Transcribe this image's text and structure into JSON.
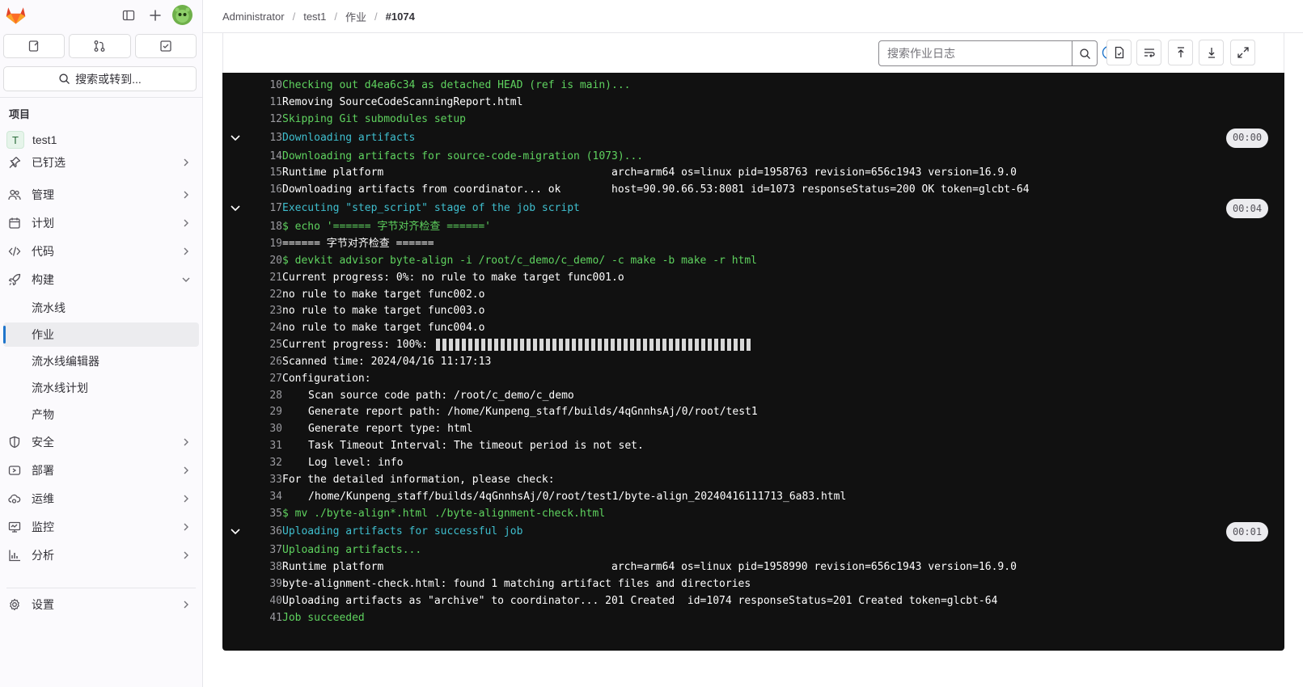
{
  "sidebar": {
    "search_label": "搜索或转到...",
    "section_title": "项目",
    "project": {
      "initial": "T",
      "name": "test1"
    },
    "items": [
      {
        "label": "已钉选",
        "icon": "pin-icon"
      },
      {
        "label": "管理",
        "icon": "users-icon"
      },
      {
        "label": "计划",
        "icon": "calendar-icon"
      },
      {
        "label": "代码",
        "icon": "code-icon"
      },
      {
        "label": "构建",
        "icon": "rocket-icon"
      },
      {
        "label": "安全",
        "icon": "shield-icon"
      },
      {
        "label": "部署",
        "icon": "deployments-icon"
      },
      {
        "label": "运维",
        "icon": "cloud-gear-icon"
      },
      {
        "label": "监控",
        "icon": "monitor-icon"
      },
      {
        "label": "分析",
        "icon": "chart-icon"
      },
      {
        "label": "设置",
        "icon": "settings-icon"
      }
    ],
    "build_subitems": [
      "流水线",
      "作业",
      "流水线编辑器",
      "流水线计划",
      "产物"
    ],
    "active_subitem": "作业"
  },
  "breadcrumb": [
    "Administrator",
    "test1",
    "作业",
    "#1074"
  ],
  "log_toolbar": {
    "search_placeholder": "搜索作业日志"
  },
  "log": {
    "lines": [
      {
        "n": "10",
        "text": "Checking out d4ea6c34 as detached HEAD (ref is main)...",
        "color": "green"
      },
      {
        "n": "11",
        "text": "Removing SourceCodeScanningReport.html",
        "color": "white"
      },
      {
        "n": "12",
        "text": "Skipping Git submodules setup",
        "color": "green"
      },
      {
        "n": "13",
        "text": "Downloading artifacts",
        "color": "cyan",
        "section": true,
        "duration": "00:00"
      },
      {
        "n": "14",
        "text": "Downloading artifacts for source-code-migration (1073)...",
        "color": "green"
      },
      {
        "n": "15",
        "text": "Runtime platform",
        "col2": "arch=arm64 os=linux pid=1958763 revision=656c1943 version=16.9.0",
        "color": "white"
      },
      {
        "n": "16",
        "text": "Downloading artifacts from coordinator... ok",
        "col2": "host=90.90.66.53:8081 id=1073 responseStatus=200 OK token=glcbt-64",
        "color": "white"
      },
      {
        "n": "17",
        "text": "Executing \"step_script\" stage of the job script",
        "color": "cyan",
        "section": true,
        "duration": "00:04"
      },
      {
        "n": "18",
        "text": "$ echo '====== 字节对齐检查 ======'",
        "color": "green"
      },
      {
        "n": "19",
        "text": "====== 字节对齐检查 ======",
        "color": "white"
      },
      {
        "n": "20",
        "text": "$ devkit advisor byte-align -i /root/c_demo/c_demo/ -c make -b make -r html",
        "color": "green"
      },
      {
        "n": "21",
        "text": "Current progress: 0%: no rule to make target func001.o",
        "color": "white"
      },
      {
        "n": "22",
        "text": "no rule to make target func002.o",
        "color": "white"
      },
      {
        "n": "23",
        "text": "no rule to make target func003.o",
        "color": "white"
      },
      {
        "n": "24",
        "text": "no rule to make target func004.o",
        "color": "white"
      },
      {
        "n": "25",
        "text": "Current progress: 100%:",
        "color": "white",
        "progress": 1.0
      },
      {
        "n": "26",
        "text": "Scanned time: 2024/04/16 11:17:13",
        "color": "white"
      },
      {
        "n": "27",
        "text": "Configuration:",
        "color": "white"
      },
      {
        "n": "28",
        "text": "Scan source code path: /root/c_demo/c_demo",
        "color": "white",
        "indent": true
      },
      {
        "n": "29",
        "text": "Generate report path: /home/Kunpeng_staff/builds/4qGnnhsAj/0/root/test1",
        "color": "white",
        "indent": true
      },
      {
        "n": "30",
        "text": "Generate report type: html",
        "color": "white",
        "indent": true
      },
      {
        "n": "31",
        "text": "Task Timeout Interval: The timeout period is not set.",
        "color": "white",
        "indent": true
      },
      {
        "n": "32",
        "text": "Log level: info",
        "color": "white",
        "indent": true
      },
      {
        "n": "33",
        "text": "For the detailed information, please check:",
        "color": "white"
      },
      {
        "n": "34",
        "text": "/home/Kunpeng_staff/builds/4qGnnhsAj/0/root/test1/byte-align_20240416111713_6a83.html",
        "color": "white",
        "indent": true
      },
      {
        "n": "35",
        "text": "$ mv ./byte-align*.html ./byte-alignment-check.html",
        "color": "green"
      },
      {
        "n": "36",
        "text": "Uploading artifacts for successful job",
        "color": "cyan",
        "section": true,
        "duration": "00:01"
      },
      {
        "n": "37",
        "text": "Uploading artifacts...",
        "color": "green"
      },
      {
        "n": "38",
        "text": "Runtime platform",
        "col2": "arch=arm64 os=linux pid=1958990 revision=656c1943 version=16.9.0",
        "color": "white"
      },
      {
        "n": "39",
        "text": "byte-alignment-check.html: found 1 matching artifact files and directories",
        "color": "white"
      },
      {
        "n": "40",
        "text": "Uploading artifacts as \"archive\" to coordinator... 201 Created  id=1074 responseStatus=201 Created token=glcbt-64",
        "color": "white"
      },
      {
        "n": "41",
        "text": "Job succeeded",
        "color": "green"
      }
    ]
  }
}
